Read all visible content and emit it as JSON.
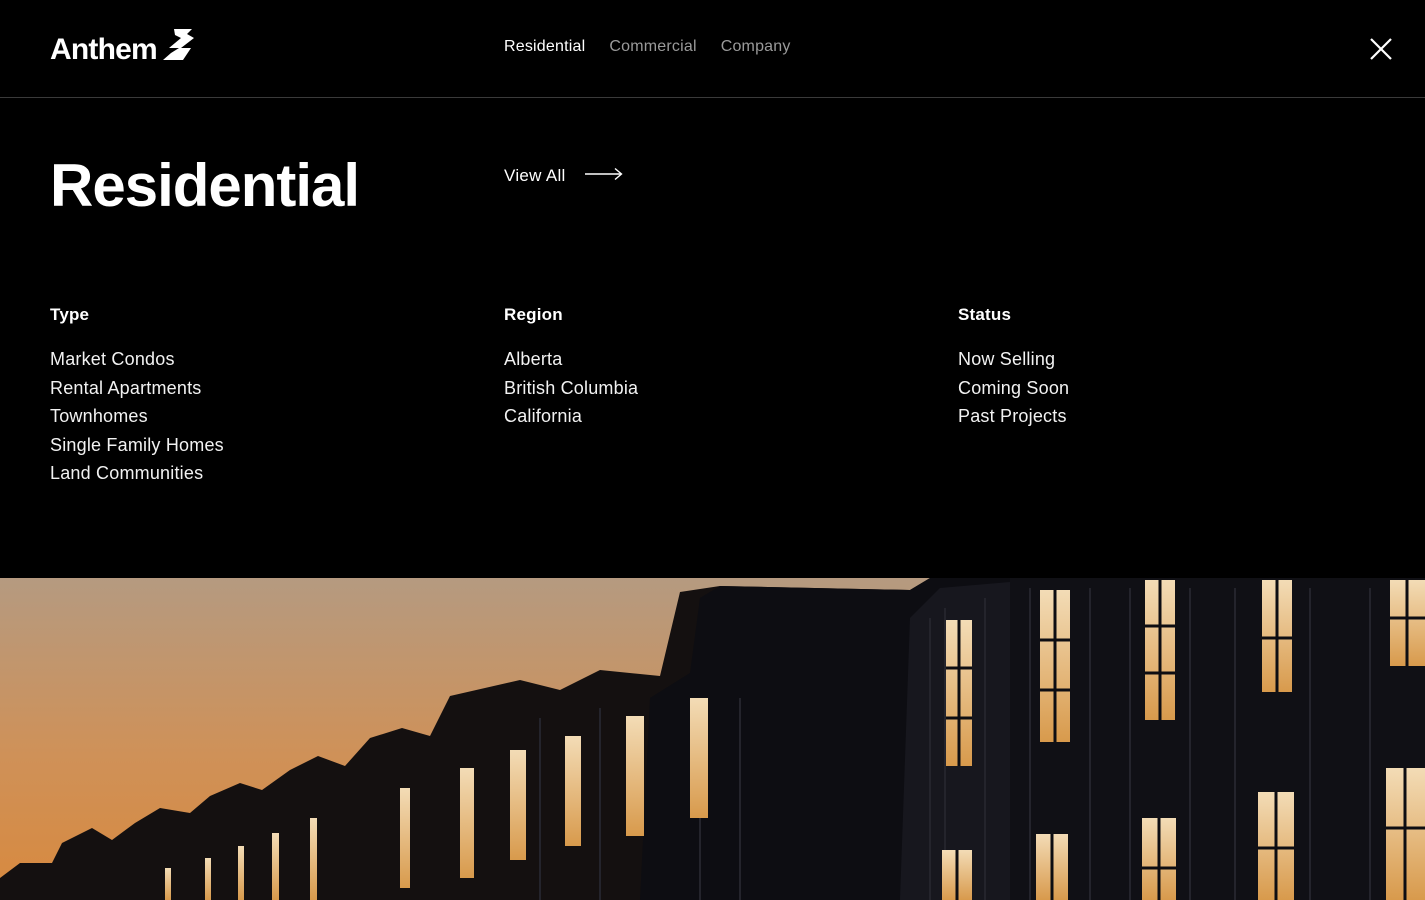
{
  "header": {
    "logo_text": "Anthem",
    "nav": [
      {
        "label": "Residential",
        "active": true
      },
      {
        "label": "Commercial",
        "active": false
      },
      {
        "label": "Company",
        "active": false
      }
    ]
  },
  "menu": {
    "title": "Residential",
    "view_all_label": "View All",
    "columns": [
      {
        "title": "Type",
        "items": [
          "Market Condos",
          "Rental Apartments",
          "Townhomes",
          "Single Family Homes",
          "Land Communities"
        ]
      },
      {
        "title": "Region",
        "items": [
          "Alberta",
          "British Columbia",
          "California"
        ]
      },
      {
        "title": "Status",
        "items": [
          "Now Selling",
          "Coming Soon",
          "Past Projects"
        ]
      }
    ]
  },
  "colors": {
    "background": "#000000",
    "text": "#ffffff",
    "nav_inactive": "#9a9a9a",
    "divider": "#3a3a3a",
    "sky_top": "#b59a80",
    "sky_bottom": "#d8893e"
  },
  "icons": {
    "logo_mark": "anthem-bolt-icon",
    "close": "close-icon",
    "view_all": "arrow-right-icon"
  }
}
